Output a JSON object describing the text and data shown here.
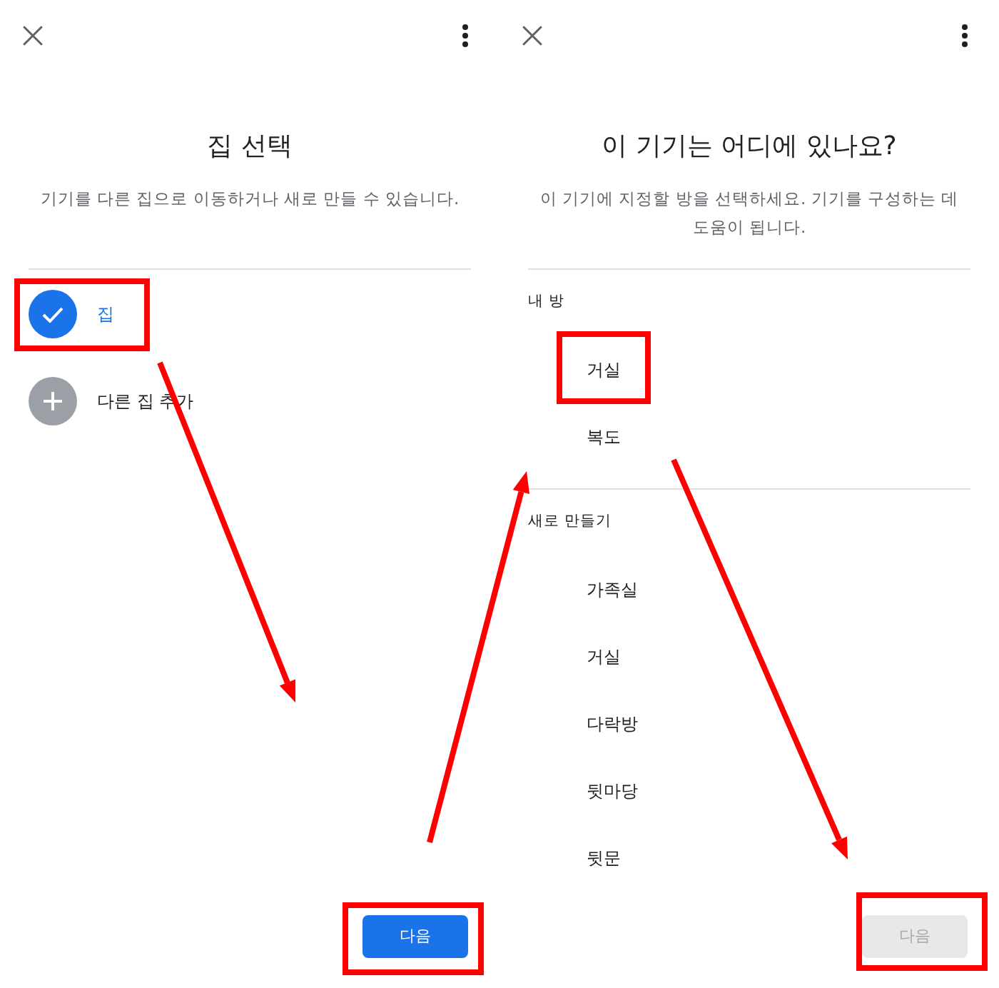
{
  "screens": [
    {
      "kind": "home_picker",
      "title": "집 선택",
      "subtitle": "기기를 다른 집으로 이동하거나 새로 만들 수 있습니다.",
      "options": [
        {
          "label": "집",
          "kind": "existing",
          "selected": true,
          "highlighted": true
        },
        {
          "label": "다른 집 추가",
          "kind": "add",
          "selected": false,
          "highlighted": false
        }
      ],
      "next_button": {
        "label": "다음",
        "disabled": false,
        "highlighted": true
      }
    },
    {
      "kind": "room_picker",
      "title": "이 기기는 어디에 있나요?",
      "subtitle": "이 기기에 지정할 방을 선택하세요. 기기를 구성하는 데 도움이 됩니다.",
      "sections": [
        {
          "heading": "내 방",
          "rooms": [
            {
              "label": "거실",
              "selected": false,
              "highlighted": true
            },
            {
              "label": "복도",
              "selected": false,
              "highlighted": false
            }
          ]
        },
        {
          "heading": "새로 만들기",
          "rooms": [
            {
              "label": "가족실",
              "selected": false,
              "highlighted": false
            },
            {
              "label": "거실",
              "selected": false,
              "highlighted": false
            },
            {
              "label": "다락방",
              "selected": false,
              "highlighted": false
            },
            {
              "label": "뒷마당",
              "selected": false,
              "highlighted": false
            },
            {
              "label": "뒷문",
              "selected": false,
              "highlighted": false
            }
          ]
        }
      ],
      "next_button": {
        "label": "다음",
        "disabled": true,
        "highlighted": true
      }
    }
  ]
}
